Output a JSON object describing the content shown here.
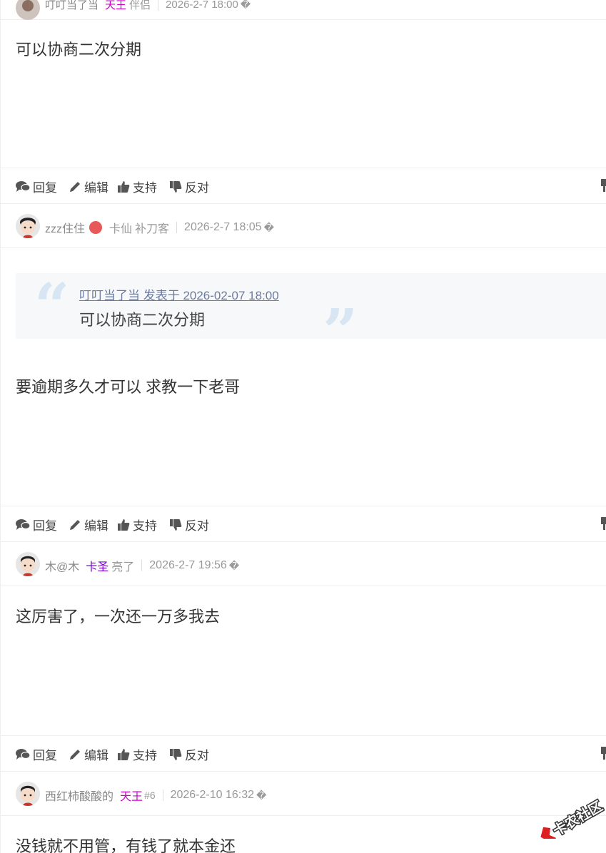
{
  "top_partial": {
    "name": "叮叮当了当",
    "rank": "天王",
    "title": "伴侣",
    "time": "2026-2-7 18:00",
    "glyph": "�"
  },
  "post1": {
    "body": "可以协商二次分期"
  },
  "actions": {
    "reply": "回复",
    "edit": "编辑",
    "support": "支持",
    "oppose": "反对"
  },
  "post2": {
    "name": "zzz住住",
    "rank": "卡仙",
    "title": "补刀客",
    "time": "2026-2-7 18:05",
    "glyph": "�",
    "quote_author": "叮叮当了当 发表于 2026-02-07 18:00",
    "quote_text": "可以协商二次分期",
    "body": "要逾期多久才可以 求教一下老哥"
  },
  "post3": {
    "name": "木@木",
    "rank": "卡圣",
    "title": "亮了",
    "time": "2026-2-7 19:56",
    "glyph": "�",
    "body": "这厉害了，一次还一万多我去"
  },
  "post4": {
    "name": "西红柿酸酸的",
    "rank": "天王",
    "floor": "#6",
    "time": "2026-2-10 16:32",
    "glyph": "�",
    "body": "没钱就不用管，有钱了就本金还"
  },
  "watermark": {
    "text": "卡农社区"
  },
  "colors": {
    "rank_purple": "#7a00cc",
    "rank_magenta": "#cc00cc",
    "border": "#eeeeee",
    "quote_bg": "#f7f8fa"
  }
}
